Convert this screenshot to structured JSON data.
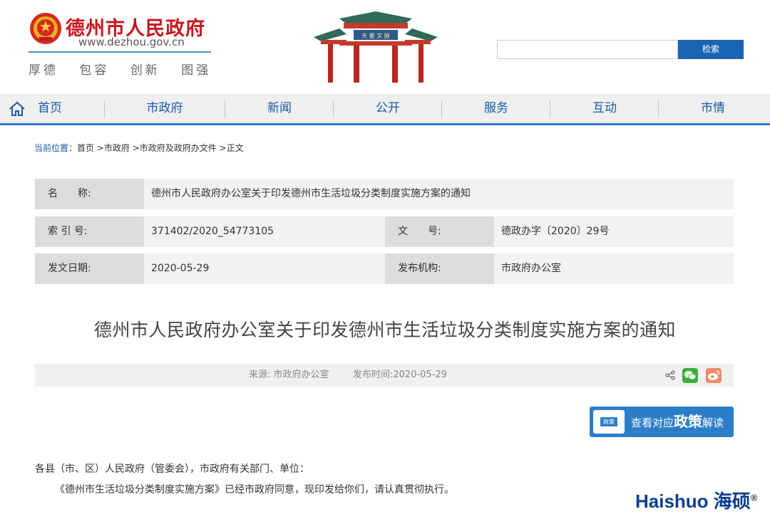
{
  "header": {
    "site_name": "德州市人民政府",
    "site_url": "www.dezhou.gov.cn",
    "motto": [
      "厚德",
      "包容",
      "创新",
      "图强"
    ],
    "gate_plaque": "天 衢 文 脉",
    "search": {
      "placeholder": "",
      "button_label": "检索"
    }
  },
  "nav": {
    "items": [
      "首页",
      "市政府",
      "新闻",
      "公开",
      "服务",
      "互动",
      "市情"
    ]
  },
  "breadcrumb": {
    "label": "当前位置：",
    "items": [
      "首页",
      ">市政府",
      ">市政府及政府办文件",
      ">正文"
    ]
  },
  "info_table": {
    "name_label": "名　　称:",
    "name_value": "德州市人民政府办公室关于印发德州市生活垃圾分类制度实施方案的通知",
    "index_label": "索 引 号:",
    "index_value": "371402/2020_54773105",
    "doc_no_label": "文　　号:",
    "doc_no_value": "德政办字〔2020〕29号",
    "date_label": "发文日期:",
    "date_value": "2020-05-29",
    "org_label": "发布机构:",
    "org_value": "市政府办公室"
  },
  "article": {
    "title": "德州市人民政府办公室关于印发德州市生活垃圾分类制度实施方案的通知",
    "source": "来源: 市政府办公室",
    "publish_time": "发布时间:2020-05-29",
    "policy_button": {
      "badge": "政策",
      "prefix": "查看对应",
      "emphasis": "政策",
      "suffix": "解读"
    },
    "paragraphs": [
      "各县（市、区）人民政府（管委会），市政府有关部门、单位：",
      "《德州市生活垃圾分类制度实施方案》已经市政府同意，现印发给你们，请认真贯彻执行。"
    ]
  },
  "watermark": {
    "text": "Haishuo 海硕",
    "mark": "®"
  },
  "colors": {
    "brand_red": "#c8161d",
    "nav_blue": "#1a5aa8",
    "accent_blue": "#2d7ec9",
    "wechat_green": "#3bb13b",
    "weibo_orange": "#f08a6a"
  }
}
